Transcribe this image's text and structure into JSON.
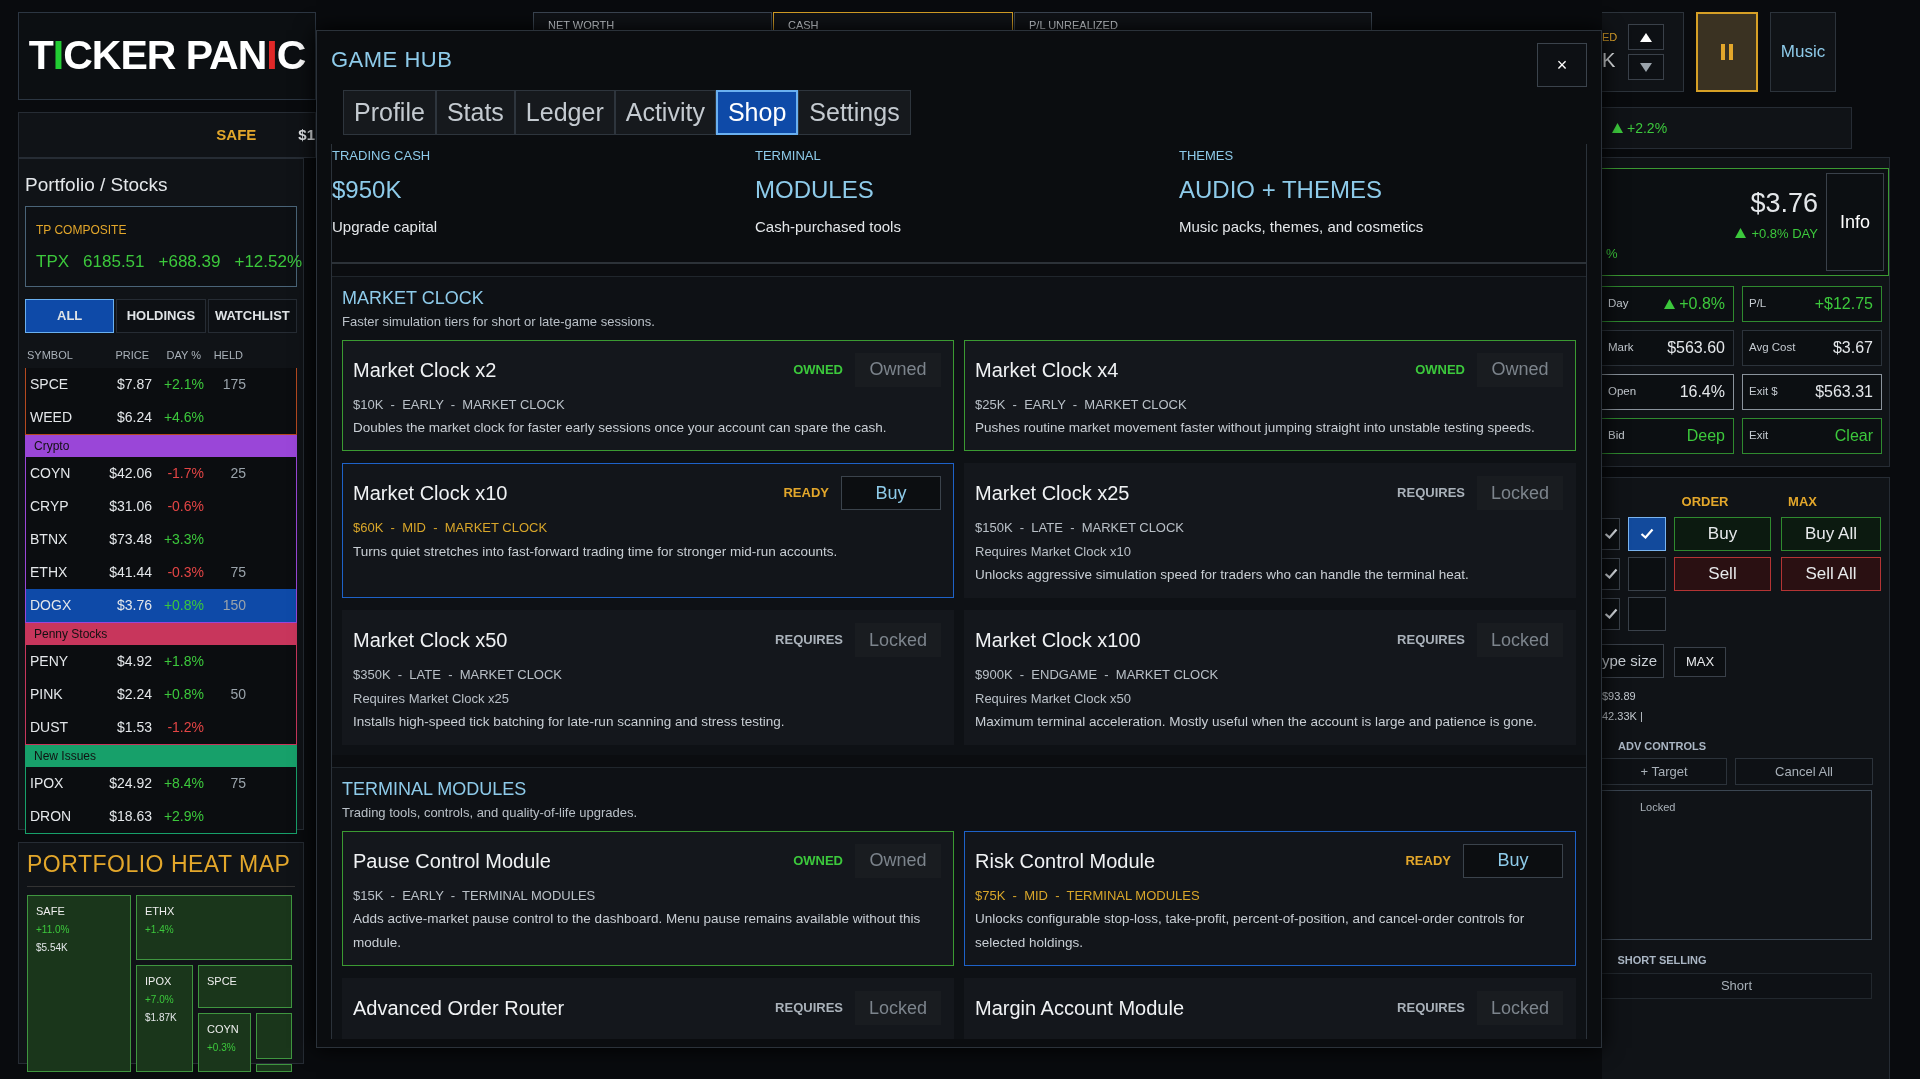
{
  "logo": {
    "parts": [
      {
        "text": "T",
        "kind": "letters"
      },
      {
        "text": "I",
        "kind": "rising"
      },
      {
        "text": "CKER PAN",
        "kind": "letters"
      },
      {
        "text": "I",
        "kind": "falling"
      },
      {
        "text": "C",
        "kind": "letters"
      }
    ]
  },
  "ticker_bar": {
    "label": "SAFE",
    "value": "$1"
  },
  "portfolio": {
    "title": "Portfolio / Stocks",
    "composite": {
      "label": "TP COMPOSITE",
      "symbol": "TPX",
      "value": "6185.51",
      "change": "+688.39",
      "percent": "+12.52%"
    },
    "filters": [
      {
        "label": "ALL",
        "selected": true
      },
      {
        "label": "HOLDINGS",
        "selected": false
      },
      {
        "label": "WATCHLIST",
        "selected": false
      }
    ],
    "columns": [
      "SYMBOL",
      "PRICE",
      "DAY %",
      "HELD"
    ],
    "groups": [
      {
        "color": "#b5491f",
        "rows": [
          {
            "symbol": "SPCE",
            "price": "$7.87",
            "day": "+2.1%",
            "rising": true,
            "held": "175",
            "selected": false
          },
          {
            "symbol": "WEED",
            "price": "$6.24",
            "day": "+4.6%",
            "rising": true,
            "selected": false
          }
        ]
      },
      {
        "name": "Crypto",
        "color": "#9a46d8",
        "rows": [
          {
            "symbol": "COYN",
            "price": "$42.06",
            "day": "-1.7%",
            "rising": false,
            "held": "25",
            "selected": false
          },
          {
            "symbol": "CRYP",
            "price": "$31.06",
            "day": "-0.6%",
            "rising": false,
            "selected": false
          },
          {
            "symbol": "BTNX",
            "price": "$73.48",
            "day": "+3.3%",
            "rising": true,
            "selected": false
          },
          {
            "symbol": "ETHX",
            "price": "$41.44",
            "day": "-0.3%",
            "rising": false,
            "held": "75",
            "selected": false
          },
          {
            "symbol": "DOGX",
            "price": "$3.76",
            "day": "+0.8%",
            "rising": true,
            "held": "150",
            "selected": true
          }
        ]
      },
      {
        "name": "Penny Stocks",
        "color": "#c8365c",
        "rows": [
          {
            "symbol": "PENY",
            "price": "$4.92",
            "day": "+1.8%",
            "rising": true,
            "selected": false
          },
          {
            "symbol": "PINK",
            "price": "$2.24",
            "day": "+0.8%",
            "rising": true,
            "held": "50",
            "selected": false
          },
          {
            "symbol": "DUST",
            "price": "$1.53",
            "day": "-1.2%",
            "rising": false,
            "selected": false
          }
        ]
      },
      {
        "name": "New Issues",
        "color": "#17a06a",
        "rows": [
          {
            "symbol": "IPOX",
            "price": "$24.92",
            "day": "+8.4%",
            "rising": true,
            "held": "75",
            "selected": false
          },
          {
            "symbol": "DRON",
            "price": "$18.63",
            "day": "+2.9%",
            "rising": true,
            "selected": false
          }
        ]
      }
    ]
  },
  "heat_map": {
    "title": "PORTFOLIO HEAT MAP",
    "tiles": [
      {
        "name": "SAFE",
        "change": "+11.0%",
        "value": "$5.54K"
      },
      {
        "name": "ETHX",
        "change": "+1.4%"
      },
      {
        "name": "IPOX",
        "change": "+7.0%",
        "value": "$1.87K"
      },
      {
        "name": "SPCE"
      },
      {
        "name": "COYN",
        "change": "+0.3%"
      }
    ]
  },
  "header_stats": [
    {
      "label": "NET WORTH",
      "highlight": false
    },
    {
      "label": "CASH",
      "highlight": true
    },
    {
      "label": "P/L UNREALIZED",
      "highlight": false
    }
  ],
  "speed_box": {
    "label": "ED",
    "value": "K"
  },
  "pause_button": {
    "active": true
  },
  "music_button": "Music",
  "index_change": "+2.2%",
  "stock_card": {
    "percent": "%",
    "price": "$3.76",
    "change": "+0.8% DAY",
    "info": "Info"
  },
  "stats": [
    {
      "label": "Day",
      "value": "+0.8%",
      "kind": "positive",
      "arrow": true
    },
    {
      "label": "P/L",
      "value": "+$12.75",
      "kind": "positive",
      "arrow": false
    },
    {
      "label": "Mark",
      "value": "$563.60",
      "kind": "neutral",
      "arrow": false
    },
    {
      "label": "Avg Cost",
      "value": "$3.67",
      "kind": "neutral",
      "arrow": false
    },
    {
      "label": "Open",
      "value": "16.4%",
      "kind": "outline",
      "arrow": false
    },
    {
      "label": "Exit $",
      "value": "$563.31",
      "kind": "outline",
      "arrow": false
    },
    {
      "label": "Bid",
      "value": "Deep",
      "kind": "positive",
      "arrow": false
    },
    {
      "label": "Exit",
      "value": "Clear",
      "kind": "positive",
      "arrow": false
    }
  ],
  "order": {
    "headers": [
      "ORDER",
      "MAX"
    ],
    "rows": [
      {
        "option_checked": true,
        "checked": true,
        "actions": [
          {
            "label": "Buy",
            "kind": "buy"
          },
          {
            "label": "Buy All",
            "kind": "buy"
          }
        ]
      },
      {
        "option_checked": true,
        "checked": false,
        "actions": [
          {
            "label": "Sell",
            "kind": "sell"
          },
          {
            "label": "Sell All",
            "kind": "sell"
          }
        ]
      },
      {
        "option_checked": true,
        "checked": false
      }
    ],
    "size_field": {
      "placeholder": "ype size"
    },
    "max_button": "MAX",
    "balance": "$93.89",
    "volume": "42.33K |",
    "adv_title": "ADV CONTROLS",
    "adv_buttons": [
      "+ Target",
      "Cancel All"
    ],
    "locked_note": "Locked",
    "short_title": "SHORT SELLING",
    "short_button": "Short"
  },
  "game_hub": {
    "title": "GAME HUB",
    "close": "×",
    "tabs": [
      {
        "label": "Profile",
        "selected": false
      },
      {
        "label": "Stats",
        "selected": false
      },
      {
        "label": "Ledger",
        "selected": false
      },
      {
        "label": "Activity",
        "selected": false
      },
      {
        "label": "Shop",
        "selected": true
      },
      {
        "label": "Settings",
        "selected": false
      }
    ],
    "summary": [
      {
        "label": "TRADING CASH",
        "value": "$950K",
        "note": "Upgrade capital"
      },
      {
        "label": "TERMINAL",
        "value": "MODULES",
        "note": "Cash-purchased tools"
      },
      {
        "label": "THEMES",
        "value": "AUDIO + THEMES",
        "note": "Music packs, themes, and cosmetics"
      }
    ],
    "sections": [
      {
        "title": "MARKET CLOCK",
        "subtitle": "Faster simulation tiers for short or late-game sessions.",
        "items": [
          {
            "name": "Market Clock x2",
            "kind": "owned",
            "status": "OWNED",
            "button": "Owned",
            "meta": "$10K  -  EARLY  -  MARKET CLOCK",
            "description": "Doubles the market clock for faster early sessions once your account can spare the cash."
          },
          {
            "name": "Market Clock x4",
            "kind": "owned",
            "status": "OWNED",
            "button": "Owned",
            "meta": "$25K  -  EARLY  -  MARKET CLOCK",
            "description": "Pushes routine market movement faster without jumping straight into unstable testing speeds."
          },
          {
            "name": "Market Clock x10",
            "kind": "ready",
            "status": "READY",
            "button": "Buy",
            "meta": "$60K  -  MID  -  MARKET CLOCK",
            "description": "Turns quiet stretches into fast-forward trading time for stronger mid-run accounts."
          },
          {
            "name": "Market Clock x25",
            "kind": "locked",
            "status": "REQUIRES",
            "button": "Locked",
            "meta": "$150K  -  LATE  -  MARKET CLOCK",
            "requires": "Requires Market Clock x10",
            "description": "Unlocks aggressive simulation speed for traders who can handle the terminal heat."
          },
          {
            "name": "Market Clock x50",
            "kind": "locked",
            "status": "REQUIRES",
            "button": "Locked",
            "meta": "$350K  -  LATE  -  MARKET CLOCK",
            "requires": "Requires Market Clock x25",
            "description": "Installs high-speed tick batching for late-run scanning and stress testing."
          },
          {
            "name": "Market Clock x100",
            "kind": "locked",
            "status": "REQUIRES",
            "button": "Locked",
            "meta": "$900K  -  ENDGAME  -  MARKET CLOCK",
            "requires": "Requires Market Clock x50",
            "description": "Maximum terminal acceleration. Mostly useful when the account is large and patience is gone."
          }
        ]
      },
      {
        "title": "TERMINAL MODULES",
        "subtitle": "Trading tools, controls, and quality-of-life upgrades.",
        "items": [
          {
            "name": "Pause Control Module",
            "kind": "owned",
            "status": "OWNED",
            "button": "Owned",
            "meta": "$15K  -  EARLY  -  TERMINAL MODULES",
            "description": "Adds active-market pause control to the dashboard. Menu pause remains available without this module."
          },
          {
            "name": "Risk Control Module",
            "kind": "ready",
            "status": "READY",
            "button": "Buy",
            "meta": "$75K  -  MID  -  TERMINAL MODULES",
            "description": "Unlocks configurable stop-loss, take-profit, percent-of-position, and cancel-order controls for selected holdings."
          },
          {
            "name": "Advanced Order Router",
            "kind": "locked",
            "status": "REQUIRES",
            "button": "Locked"
          },
          {
            "name": "Margin Account Module",
            "kind": "locked",
            "status": "REQUIRES",
            "button": "Locked"
          }
        ]
      }
    ]
  }
}
